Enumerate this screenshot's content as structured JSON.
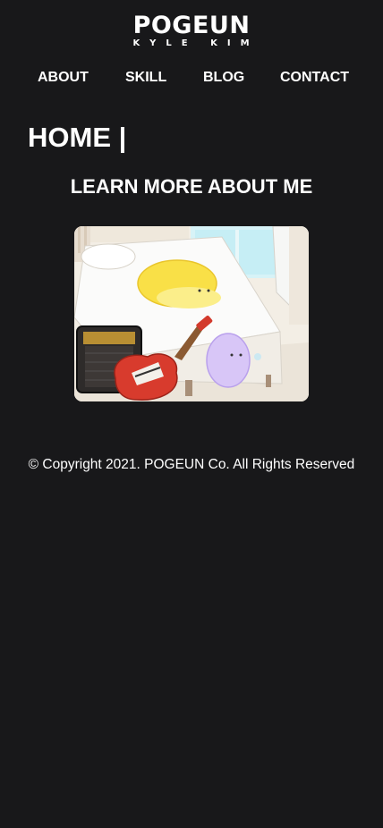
{
  "header": {
    "logo_main": "POGEUN",
    "logo_sub": "KYLE KIM"
  },
  "nav": {
    "items": [
      {
        "label": "ABOUT"
      },
      {
        "label": "SKILL"
      },
      {
        "label": "BLOG"
      },
      {
        "label": "CONTACT"
      }
    ]
  },
  "main": {
    "title": "HOME |",
    "subtitle": "LEARN MORE ABOUT ME"
  },
  "hero_image": {
    "alt": "Illustration of a bedroom with a guitar amp, red electric guitar, a yellow hedgehog lying on the bed and a purple hedgehog"
  },
  "footer": {
    "copyright": "© Copyright 2021. POGEUN Co. All Rights Reserved"
  },
  "colors": {
    "background": "#18181a",
    "text": "#ffffff"
  }
}
